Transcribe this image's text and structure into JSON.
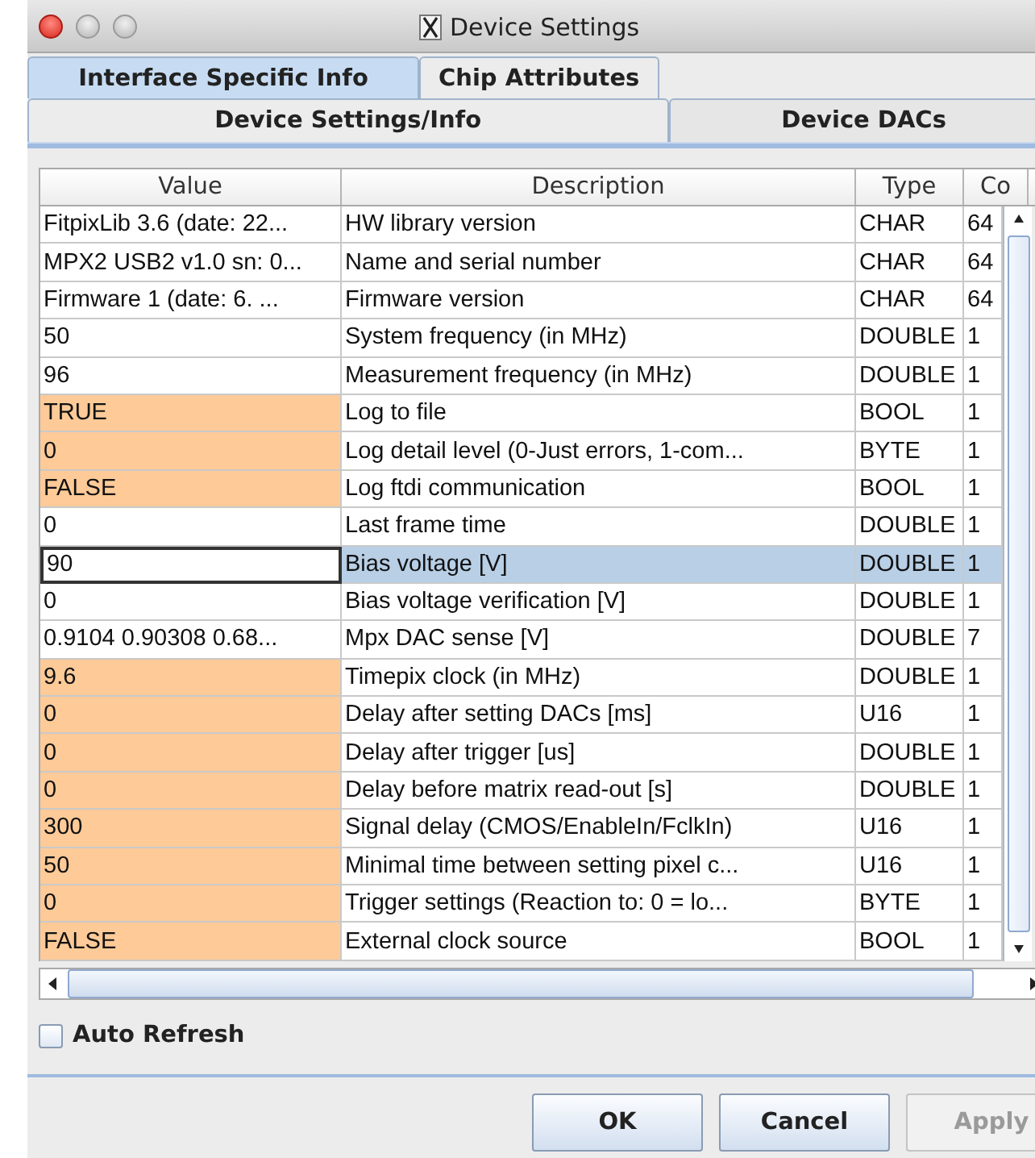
{
  "window": {
    "title": "Device Settings"
  },
  "tabs": [
    {
      "label": "Interface Specific Info",
      "selected": true
    },
    {
      "label": "Chip Attributes",
      "selected": false
    }
  ],
  "subtabs": [
    {
      "label": "Device Settings/Info",
      "selected": true
    },
    {
      "label": "Device DACs",
      "selected": false
    }
  ],
  "table": {
    "columns": [
      "Value",
      "Description",
      "Type",
      "Co"
    ],
    "rows": [
      {
        "value": "FitpixLib 3.6 (date: 22...",
        "description": "HW library version",
        "type": "CHAR",
        "count": "64",
        "modified": false,
        "selected": false
      },
      {
        "value": "MPX2 USB2 v1.0 sn: 0...",
        "description": "Name and serial number",
        "type": "CHAR",
        "count": "64",
        "modified": false,
        "selected": false
      },
      {
        "value": "Firmware 1 (date: 6. ...",
        "description": "Firmware version",
        "type": "CHAR",
        "count": "64",
        "modified": false,
        "selected": false
      },
      {
        "value": "50",
        "description": "System frequency (in MHz)",
        "type": "DOUBLE",
        "count": "1",
        "modified": false,
        "selected": false
      },
      {
        "value": "96",
        "description": "Measurement frequency (in MHz)",
        "type": "DOUBLE",
        "count": "1",
        "modified": false,
        "selected": false
      },
      {
        "value": "TRUE",
        "description": "Log to file",
        "type": "BOOL",
        "count": "1",
        "modified": true,
        "selected": false
      },
      {
        "value": "0",
        "description": "Log detail level (0-Just errors, 1-com...",
        "type": "BYTE",
        "count": "1",
        "modified": true,
        "selected": false
      },
      {
        "value": "FALSE",
        "description": "Log ftdi communication",
        "type": "BOOL",
        "count": "1",
        "modified": true,
        "selected": false
      },
      {
        "value": "0",
        "description": "Last frame time",
        "type": "DOUBLE",
        "count": "1",
        "modified": false,
        "selected": false
      },
      {
        "value": "90",
        "description": "Bias voltage [V]",
        "type": "DOUBLE",
        "count": "1",
        "modified": false,
        "selected": true
      },
      {
        "value": "0",
        "description": "Bias voltage verification [V]",
        "type": "DOUBLE",
        "count": "1",
        "modified": false,
        "selected": false
      },
      {
        "value": "0.9104 0.90308 0.68...",
        "description": "Mpx DAC sense [V]",
        "type": "DOUBLE",
        "count": "7",
        "modified": false,
        "selected": false
      },
      {
        "value": "9.6",
        "description": "Timepix clock (in MHz)",
        "type": "DOUBLE",
        "count": "1",
        "modified": true,
        "selected": false
      },
      {
        "value": "0",
        "description": "Delay after setting DACs [ms]",
        "type": "U16",
        "count": "1",
        "modified": true,
        "selected": false
      },
      {
        "value": "0",
        "description": "Delay after trigger [us]",
        "type": "DOUBLE",
        "count": "1",
        "modified": true,
        "selected": false
      },
      {
        "value": "0",
        "description": "Delay before matrix read-out [s]",
        "type": "DOUBLE",
        "count": "1",
        "modified": true,
        "selected": false
      },
      {
        "value": "300",
        "description": "Signal delay (CMOS/EnableIn/FclkIn)",
        "type": "U16",
        "count": "1",
        "modified": true,
        "selected": false
      },
      {
        "value": "50",
        "description": "Minimal time between setting pixel c...",
        "type": "U16",
        "count": "1",
        "modified": true,
        "selected": false
      },
      {
        "value": "0",
        "description": "Trigger settings (Reaction to: 0 = lo...",
        "type": "BYTE",
        "count": "1",
        "modified": true,
        "selected": false
      },
      {
        "value": "FALSE",
        "description": "External clock source",
        "type": "BOOL",
        "count": "1",
        "modified": true,
        "selected": false
      }
    ]
  },
  "auto_refresh": {
    "label": "Auto Refresh",
    "checked": false
  },
  "buttons": [
    {
      "label": "OK",
      "disabled": false
    },
    {
      "label": "Cancel",
      "disabled": false
    },
    {
      "label": "Apply",
      "disabled": true
    }
  ]
}
